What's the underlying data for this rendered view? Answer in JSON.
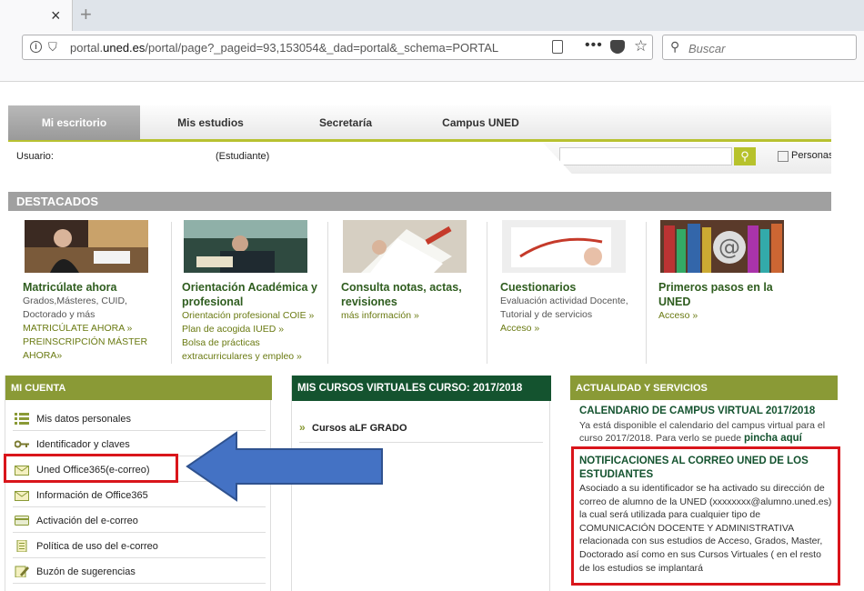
{
  "browser": {
    "url_domain_pre": "portal.",
    "url_domain": "uned.es",
    "url_path": "/portal/page?_pageid=93,153054&_dad=portal&_schema=PORTAL",
    "search_placeholder": "Buscar",
    "new_tab": "+",
    "close_tab": "×"
  },
  "nav": {
    "tabs": [
      "Mi escritorio",
      "Mis estudios",
      "Secretaría",
      "Campus UNED"
    ]
  },
  "userbar": {
    "user_label": "Usuario:",
    "role": "(Estudiante)",
    "persons_label": "Personas"
  },
  "destacados": {
    "heading": "DESTACADOS",
    "items": [
      {
        "title": "Matricúlate ahora",
        "lines": [
          {
            "t": "Grados,Másteres, CUID,",
            "link": false
          },
          {
            "t": "Doctorado y más",
            "link": false
          },
          {
            "t": "MATRICÚLATE AHORA »",
            "link": true
          },
          {
            "t": "PREINSCRIPCIÓN MÁSTER",
            "link": true
          },
          {
            "t": "AHORA»",
            "link": true
          }
        ]
      },
      {
        "title": "Orientación Académica y profesional",
        "lines": [
          {
            "t": "Orientación profesional COIE »",
            "link": true
          },
          {
            "t": "Plan de acogida IUED »",
            "link": true
          },
          {
            "t": "Bolsa de prácticas",
            "link": true
          },
          {
            "t": "extracurriculares y empleo »",
            "link": true
          }
        ]
      },
      {
        "title": "Consulta notas, actas, revisiones",
        "lines": [
          {
            "t": "más información »",
            "link": true
          }
        ]
      },
      {
        "title": "Cuestionarios",
        "lines": [
          {
            "t": "Evaluación actividad Docente,",
            "link": false
          },
          {
            "t": "Tutorial y de servicios",
            "link": false
          },
          {
            "t": "Acceso »",
            "link": true
          }
        ]
      },
      {
        "title": "Primeros pasos en la UNED",
        "lines": [
          {
            "t": "Acceso »",
            "link": true
          }
        ]
      }
    ]
  },
  "mi_cuenta": {
    "heading": "MI CUENTA",
    "items": [
      {
        "label": "Mis datos personales",
        "icon": "list-icon"
      },
      {
        "label": "Identificador y claves",
        "icon": "key-icon"
      },
      {
        "label": "Uned Office365(e-correo)",
        "icon": "mail-icon"
      },
      {
        "label": "Información de Office365",
        "icon": "mail-icon"
      },
      {
        "label": "Activación del e-correo",
        "icon": "card-icon"
      },
      {
        "label": "Política de uso del e-correo",
        "icon": "document-icon"
      },
      {
        "label": "Buzón de sugerencias",
        "icon": "pencil-icon"
      }
    ]
  },
  "cursos": {
    "heading": "MIS CURSOS VIRTUALES CURSO: 2017/2018",
    "items": [
      "Cursos aLF GRADO"
    ]
  },
  "actualidad": {
    "heading": "ACTUALIDAD Y SERVICIOS",
    "news1_title": "CALENDARIO DE CAMPUS VIRTUAL 2017/2018",
    "news1_body": "Ya está disponible el calendario del campus virtual para el curso 2017/2018. Para verlo se puede",
    "news1_link": "pincha aquí",
    "news2_title": "NOTIFICACIONES AL CORREO UNED DE LOS ESTUDIANTES",
    "news2_body": "Asociado a su identificador se ha activado su dirección de correo de alumno de la UNED (xxxxxxxx@alumno.uned.es) la cual será utilizada para cualquier tipo de COMUNICACIÓN DOCENTE Y ADMINISTRATIVA relacionada con sus estudios de Acceso, Grados, Master, Doctorado así como en sus Cursos Virtuales ( en el resto de los estudios se implantará"
  },
  "colors": {
    "olive": "#8a9a36",
    "dark_green": "#14532f",
    "annotation_red": "#d9151b",
    "annotation_arrow": "#4472c4"
  }
}
